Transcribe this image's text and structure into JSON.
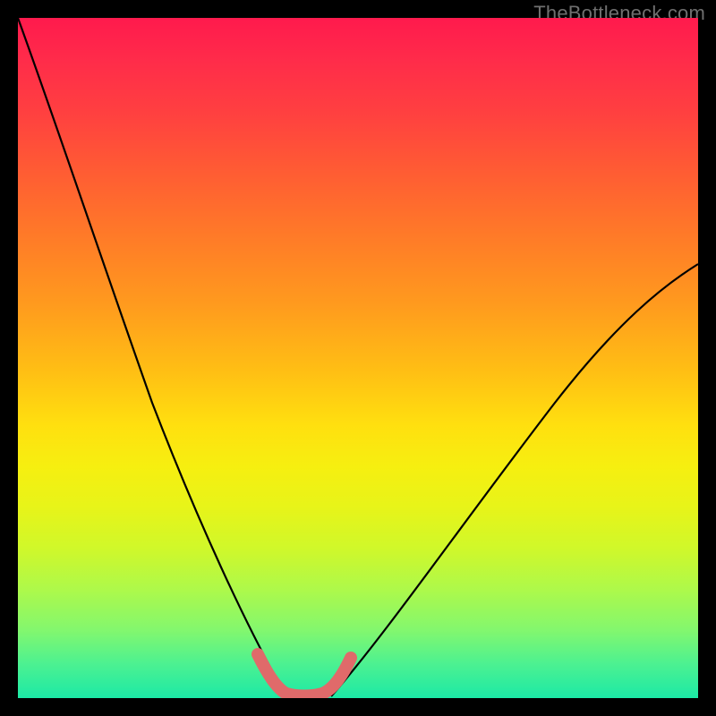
{
  "watermark": {
    "text": "TheBottleneck.com"
  },
  "colors": {
    "background": "#000000",
    "curve": "#000000",
    "bottom_marker": "#e06a6a",
    "gradient_top": "#ff1a4d",
    "gradient_bottom": "#1ce9a6"
  },
  "chart_data": {
    "type": "line",
    "title": "",
    "xlabel": "",
    "ylabel": "",
    "xlim": [
      0,
      100
    ],
    "ylim": [
      0,
      100
    ],
    "grid": false,
    "legend": false,
    "notes": "V-shaped bottleneck curve over rainbow heat gradient. Axes are unlabeled; values approximate pixel-normalized 0–100 domain. Left branch steeper than right. Minimum sits around x≈40 near y≈0. Pink rounded segments form a short U at the trough.",
    "series": [
      {
        "name": "curve_left",
        "x": [
          0,
          2,
          5,
          8,
          12,
          16,
          20,
          24,
          28,
          32,
          35,
          37,
          39
        ],
        "y": [
          100,
          93,
          83,
          74,
          64,
          54,
          44,
          34,
          24,
          14,
          7,
          3,
          0
        ]
      },
      {
        "name": "curve_right",
        "x": [
          45,
          48,
          52,
          57,
          63,
          70,
          78,
          86,
          93,
          100
        ],
        "y": [
          0,
          4,
          10,
          17,
          25,
          34,
          43,
          52,
          59,
          64
        ]
      },
      {
        "name": "trough_marker",
        "x": [
          35,
          36,
          37,
          38,
          39,
          40,
          41,
          42,
          43,
          44,
          45,
          46
        ],
        "y": [
          6.5,
          5.0,
          3.6,
          2.4,
          1.4,
          0.8,
          0.6,
          0.8,
          1.4,
          2.4,
          3.6,
          5.0
        ],
        "style": "thick-pink"
      }
    ]
  }
}
